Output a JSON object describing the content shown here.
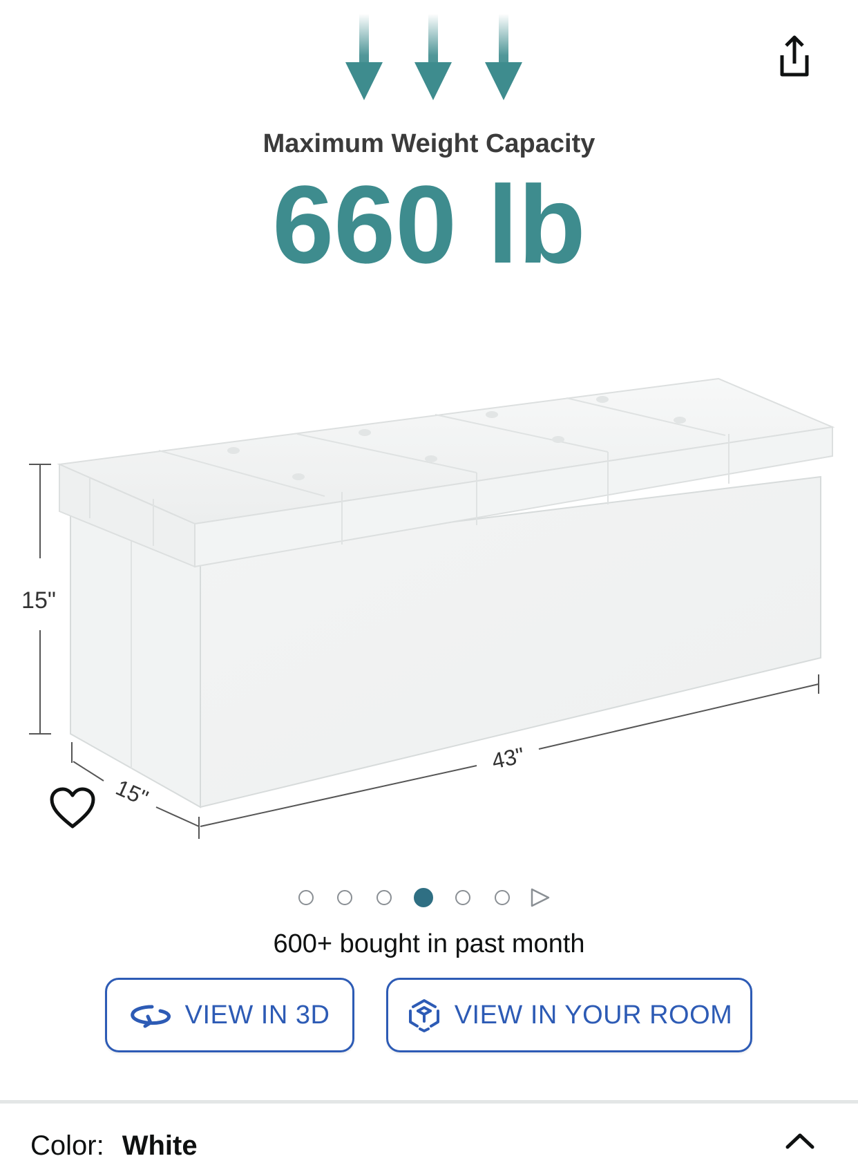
{
  "hero": {
    "heading": "Maximum Weight Capacity",
    "capacity_value": "660 lb",
    "dimension_height": "15\"",
    "dimension_width": "43\"",
    "dimension_depth": "15\""
  },
  "carousel": {
    "dot_count": 6,
    "active_index": 3
  },
  "bought_text": "600+ bought in past month",
  "buttons": {
    "view_3d_label": "VIEW IN 3D",
    "view_room_label": "VIEW IN YOUR ROOM"
  },
  "variant": {
    "label": "Color:",
    "value": "White"
  },
  "icons": [
    "share-icon",
    "heart-icon",
    "rotate-3d-icon",
    "ar-cube-icon",
    "play-arrow-icon",
    "chevron-up-icon"
  ],
  "colors": {
    "accent_teal": "#3e8c8e",
    "link_blue": "#2d5bb5",
    "active_dot": "#2f6f83"
  }
}
